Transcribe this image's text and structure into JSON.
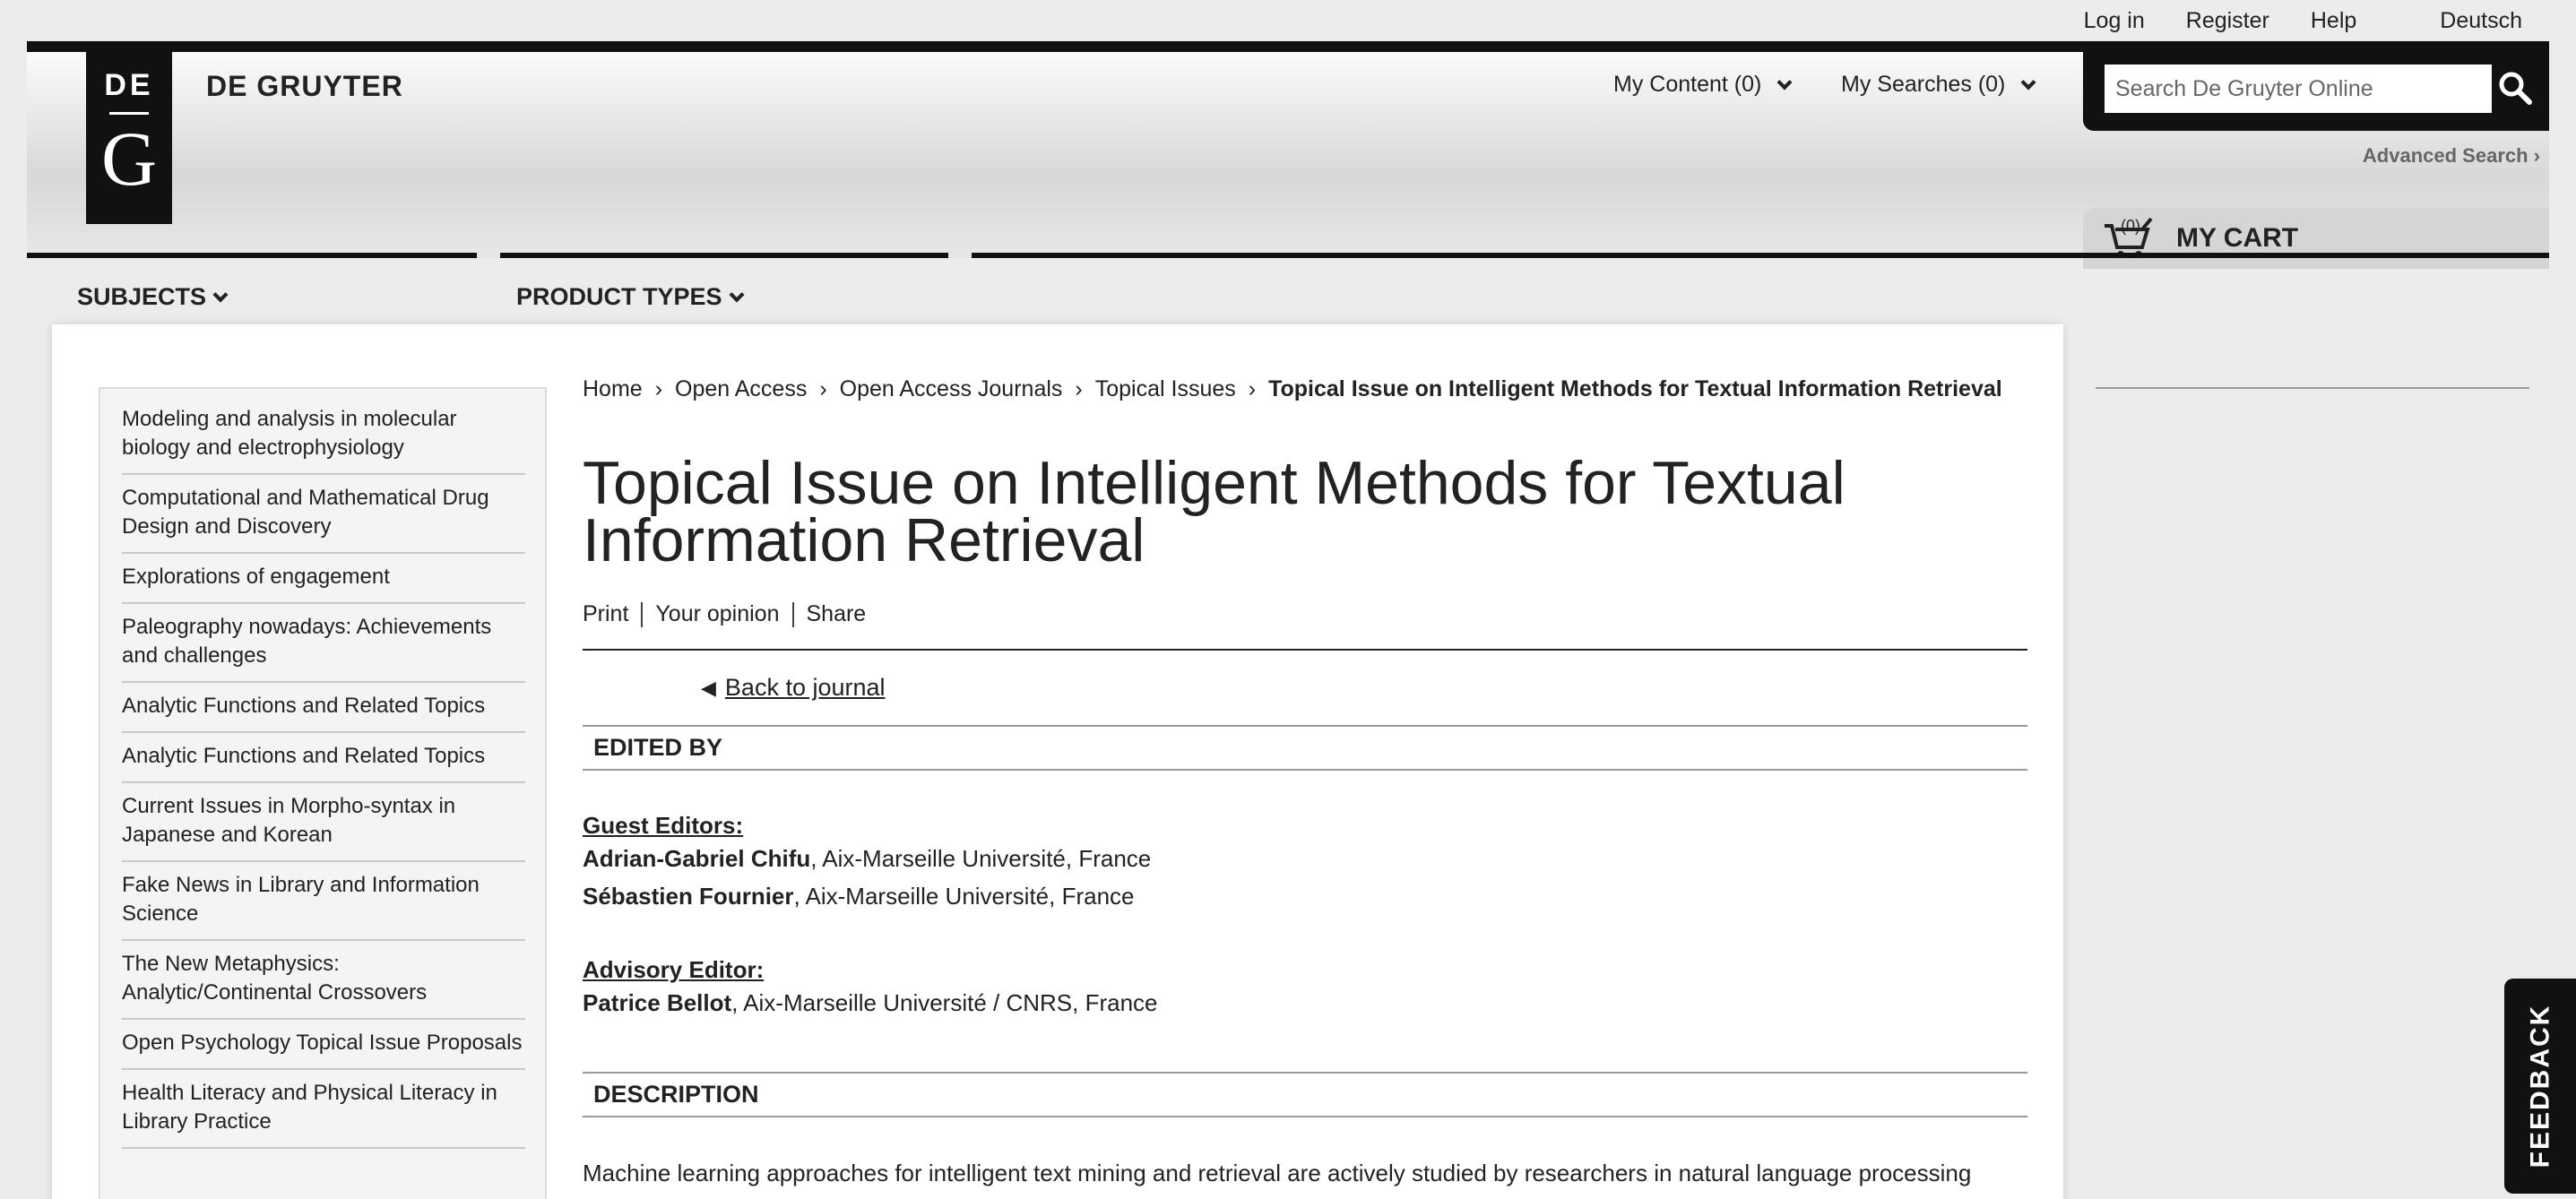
{
  "utility": {
    "login": "Log in",
    "register": "Register",
    "help": "Help",
    "language": "Deutsch"
  },
  "header": {
    "logo_top": "DE",
    "logo_bottom": "G",
    "brand": "DE GRUYTER",
    "my_content": "My Content (0)",
    "my_searches": "My Searches (0)",
    "search_placeholder": "Search De Gruyter Online",
    "advanced_search": "Advanced Search ›",
    "cart_count": "(0)",
    "cart_label": "MY CART"
  },
  "nav": {
    "subjects": "SUBJECTS",
    "product_types": "PRODUCT TYPES"
  },
  "sidebar": {
    "items": [
      "Modeling and analysis in molecular biology and electrophysiology",
      "Computational and Mathematical Drug Design and Discovery",
      "Explorations of engagement",
      "Paleography nowadays: Achievements and challenges",
      "Analytic Functions and Related Topics",
      "Analytic Functions and Related Topics",
      "Current Issues in Morpho-syntax in Japanese and Korean",
      "Fake News in Library and Information Science",
      "The New Metaphysics: Analytic/Continental Crossovers",
      "Open Psychology Topical Issue Proposals",
      "Health Literacy and Physical Literacy in Library Practice"
    ]
  },
  "breadcrumb": {
    "home": "Home",
    "open_access": "Open Access",
    "open_access_journals": "Open Access Journals",
    "topical_issues": "Topical Issues",
    "current": "Topical Issue on Intelligent Methods for Textual Information Retrieval"
  },
  "article": {
    "title": "Topical Issue on Intelligent Methods for Textual Information Retrieval",
    "print": "Print",
    "opinion": "Your opinion",
    "share": "Share",
    "back": "Back to journal",
    "edited_by": "EDITED BY",
    "guest_editors_label": "Guest Editors:",
    "guest_editors": [
      {
        "name": "Adrian-Gabriel Chifu",
        "affiliation": ", Aix-Marseille Université, France"
      },
      {
        "name": "Sébastien Fournier",
        "affiliation": ", Aix-Marseille Université, France"
      }
    ],
    "advisory_editor_label": "Advisory Editor:",
    "advisory_editor": {
      "name": "Patrice Bellot",
      "affiliation": ", Aix-Marseille Université / CNRS, France"
    },
    "description_head": "DESCRIPTION",
    "description_text": "Machine learning approaches for intelligent text mining and retrieval are actively studied by researchers in natural language processing"
  },
  "feedback": "FEEDBACK"
}
